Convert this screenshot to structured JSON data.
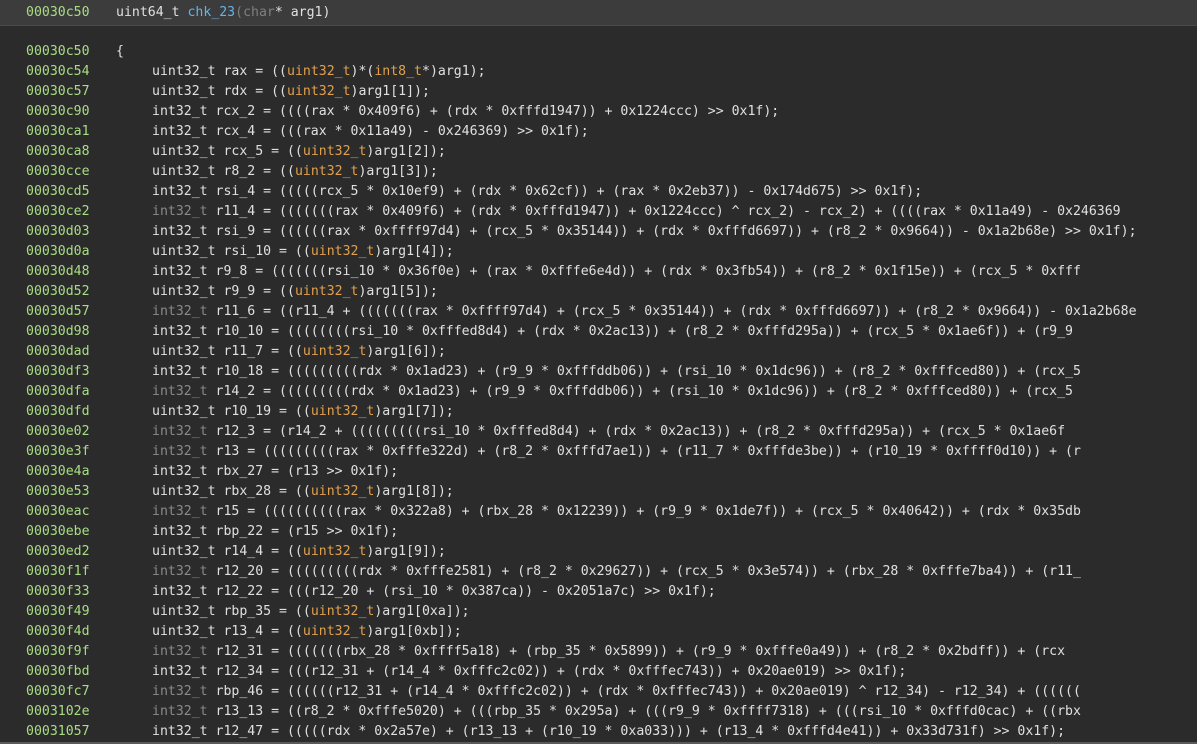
{
  "header": {
    "address": "00030c50",
    "return_type": "uint64_t",
    "function_name": "chk_23",
    "open_paren": "(",
    "param_type": "char",
    "param_rest": "* arg1",
    "close_paren": ")"
  },
  "lines": [
    {
      "addr": "00030c50",
      "code": "{"
    },
    {
      "addr": "00030c54",
      "type": "uint32_t",
      "code": " rax = ((uint32_t)*(int8_t*)arg1);"
    },
    {
      "addr": "00030c57",
      "type": "uint32_t",
      "code": " rdx = ((uint32_t)arg1[1]);"
    },
    {
      "addr": "00030c90",
      "type": "int32_t",
      "code": " rcx_2 = ((((rax * 0x409f6) + (rdx * 0xfffd1947)) + 0x1224ccc) >> 0x1f);"
    },
    {
      "addr": "00030ca1",
      "type": "int32_t",
      "code": " rcx_4 = (((rax * 0x11a49) - 0x246369) >> 0x1f);"
    },
    {
      "addr": "00030ca8",
      "type": "uint32_t",
      "code": " rcx_5 = ((uint32_t)arg1[2]);"
    },
    {
      "addr": "00030cce",
      "type": "uint32_t",
      "code": " r8_2 = ((uint32_t)arg1[3]);"
    },
    {
      "addr": "00030cd5",
      "type": "int32_t",
      "code": " rsi_4 = (((((rcx_5 * 0x10ef9) + (rdx * 0x62cf)) + (rax * 0x2eb37)) - 0x174d675) >> 0x1f);"
    },
    {
      "addr": "00030ce2",
      "type": "int32_t",
      "dim": true,
      "code": " r11_4 = (((((((rax * 0x409f6) + (rdx * 0xfffd1947)) + 0x1224ccc) ^ rcx_2) - rcx_2) + ((((rax * 0x11a49) - 0x246369"
    },
    {
      "addr": "00030d03",
      "type": "int32_t",
      "code": " rsi_9 = ((((((rax * 0xffff97d4) + (rcx_5 * 0x35144)) + (rdx * 0xfffd6697)) + (r8_2 * 0x9664)) - 0x1a2b68e) >> 0x1f);"
    },
    {
      "addr": "00030d0a",
      "type": "uint32_t",
      "code": " rsi_10 = ((uint32_t)arg1[4]);"
    },
    {
      "addr": "00030d48",
      "type": "int32_t",
      "code": " r9_8 = (((((((rsi_10 * 0x36f0e) + (rax * 0xfffe6e4d)) + (rdx * 0x3fb54)) + (r8_2 * 0x1f15e)) + (rcx_5 * 0xfff"
    },
    {
      "addr": "00030d52",
      "type": "uint32_t",
      "code": " r9_9 = ((uint32_t)arg1[5]);"
    },
    {
      "addr": "00030d57",
      "type": "int32_t",
      "dim": true,
      "code": " r11_6 = ((r11_4 + (((((((rax * 0xffff97d4) + (rcx_5 * 0x35144)) + (rdx * 0xfffd6697)) + (r8_2 * 0x9664)) - 0x1a2b68e"
    },
    {
      "addr": "00030d98",
      "type": "int32_t",
      "code": " r10_10 = ((((((((rsi_10 * 0xfffed8d4) + (rdx * 0x2ac13)) + (r8_2 * 0xfffd295a)) + (rcx_5 * 0x1ae6f)) + (r9_9"
    },
    {
      "addr": "00030dad",
      "type": "uint32_t",
      "code": " r11_7 = ((uint32_t)arg1[6]);"
    },
    {
      "addr": "00030df3",
      "type": "int32_t",
      "code": " r10_18 = (((((((((rdx * 0x1ad23) + (r9_9 * 0xfffddb06)) + (rsi_10 * 0x1dc96)) + (r8_2 * 0xfffced80)) + (rcx_5"
    },
    {
      "addr": "00030dfa",
      "type": "int32_t",
      "dim": true,
      "code": " r14_2 = (((((((((rdx * 0x1ad23) + (r9_9 * 0xfffddb06)) + (rsi_10 * 0x1dc96)) + (r8_2 * 0xfffced80)) + (rcx_5"
    },
    {
      "addr": "00030dfd",
      "type": "uint32_t",
      "code": " r10_19 = ((uint32_t)arg1[7]);"
    },
    {
      "addr": "00030e02",
      "type": "int32_t",
      "dim": true,
      "code": " r12_3 = (r14_2 + (((((((((rsi_10 * 0xfffed8d4) + (rdx * 0x2ac13)) + (r8_2 * 0xfffd295a)) + (rcx_5 * 0x1ae6f"
    },
    {
      "addr": "00030e3f",
      "type": "int32_t",
      "dim": true,
      "code": " r13 = (((((((((rax * 0xfffe322d) + (r8_2 * 0xfffd7ae1)) + (r11_7 * 0xfffde3be)) + (r10_19 * 0xffff0d10)) + (r"
    },
    {
      "addr": "00030e4a",
      "type": "int32_t",
      "code": " rbx_27 = (r13 >> 0x1f);"
    },
    {
      "addr": "00030e53",
      "type": "uint32_t",
      "code": " rbx_28 = ((uint32_t)arg1[8]);"
    },
    {
      "addr": "00030eac",
      "type": "int32_t",
      "dim": true,
      "code": " r15 = ((((((((((rax * 0x322a8) + (rbx_28 * 0x12239)) + (r9_9 * 0x1de7f)) + (rcx_5 * 0x40642)) + (rdx * 0x35db"
    },
    {
      "addr": "00030ebe",
      "type": "int32_t",
      "code": " rbp_22 = (r15 >> 0x1f);"
    },
    {
      "addr": "00030ed2",
      "type": "uint32_t",
      "code": " r14_4 = ((uint32_t)arg1[9]);"
    },
    {
      "addr": "00030f1f",
      "type": "int32_t",
      "dim": true,
      "code": " r12_20 = (((((((((rdx * 0xfffe2581) + (r8_2 * 0x29627)) + (rcx_5 * 0x3e574)) + (rbx_28 * 0xfffe7ba4)) + (r11_"
    },
    {
      "addr": "00030f33",
      "type": "int32_t",
      "code": " r12_22 = (((r12_20 + (rsi_10 * 0x387ca)) - 0x2051a7c) >> 0x1f);"
    },
    {
      "addr": "00030f49",
      "type": "uint32_t",
      "code": " rbp_35 = ((uint32_t)arg1[0xa]);"
    },
    {
      "addr": "00030f4d",
      "type": "uint32_t",
      "code": " r13_4 = ((uint32_t)arg1[0xb]);"
    },
    {
      "addr": "00030f9f",
      "type": "int32_t",
      "dim": true,
      "code": " r12_31 = (((((((rbx_28 * 0xffff5a18) + (rbp_35 * 0x5899)) + (r9_9 * 0xfffe0a49)) + (r8_2 * 0x2bdff)) + (rcx"
    },
    {
      "addr": "00030fbd",
      "type": "int32_t",
      "code": " r12_34 = (((r12_31 + (r14_4 * 0xfffc2c02)) + (rdx * 0xfffec743)) + 0x20ae019) >> 0x1f);"
    },
    {
      "addr": "00030fc7",
      "type": "int32_t",
      "dim": true,
      "code": " rbp_46 = ((((((r12_31 + (r14_4 * 0xfffc2c02)) + (rdx * 0xfffec743)) + 0x20ae019) ^ r12_34) - r12_34) + (((((("
    },
    {
      "addr": "0003102e",
      "type": "int32_t",
      "dim": true,
      "code": " r13_13 = ((r8_2 * 0xfffe5020) + (((rbp_35 * 0x295a) + (((r9_9 * 0xffff7318) + (((rsi_10 * 0xfffd0cac) + ((rbx"
    },
    {
      "addr": "00031057",
      "type": "int32_t",
      "code": " r12_47 = (((((rdx * 0x2a57e) + (r13_13 + (r10_19 * 0xa033))) + (r13_4 * 0xfffd4e41)) + 0x33d731f) >> 0x1f);"
    }
  ]
}
